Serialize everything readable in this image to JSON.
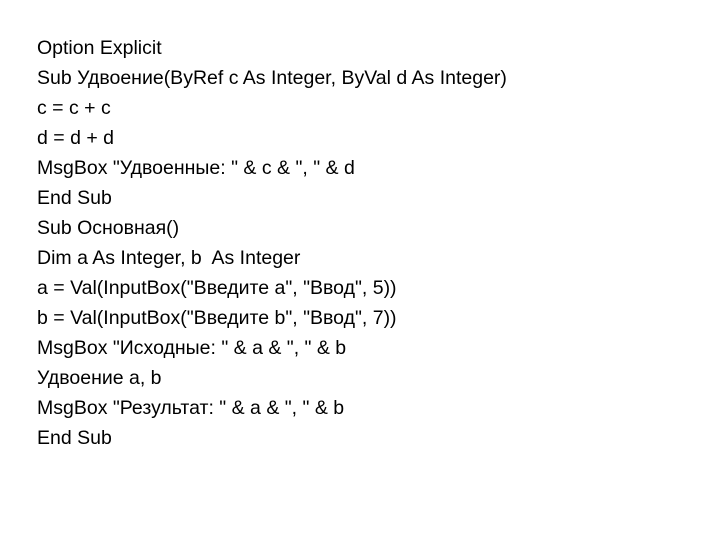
{
  "document": {
    "type": "vba-source-code-listing",
    "language": "Visual Basic for Applications",
    "background_color": "#ffffff",
    "text_color": "#000000",
    "font_size_px": 19.5,
    "line_height_px": 30,
    "line_count": 14,
    "lines": [
      "Option Explicit",
      "Sub Удвоение(ByRef c As Integer, ByVal d As Integer)",
      "c = c + c",
      "d = d + d",
      "MsgBox \"Удвоенные: \" & c & \", \" & d",
      "End Sub",
      "Sub Основная()",
      "Dim a As Integer, b  As Integer",
      "a = Val(InputBox(\"Введите a\", \"Ввод\", 5))",
      "b = Val(InputBox(\"Введите b\", \"Ввод\", 7))",
      "MsgBox \"Исходные: \" & a & \", \" & b",
      "Удвоение a, b",
      "MsgBox \"Результат: \" & a & \", \" & b",
      "End Sub"
    ]
  }
}
